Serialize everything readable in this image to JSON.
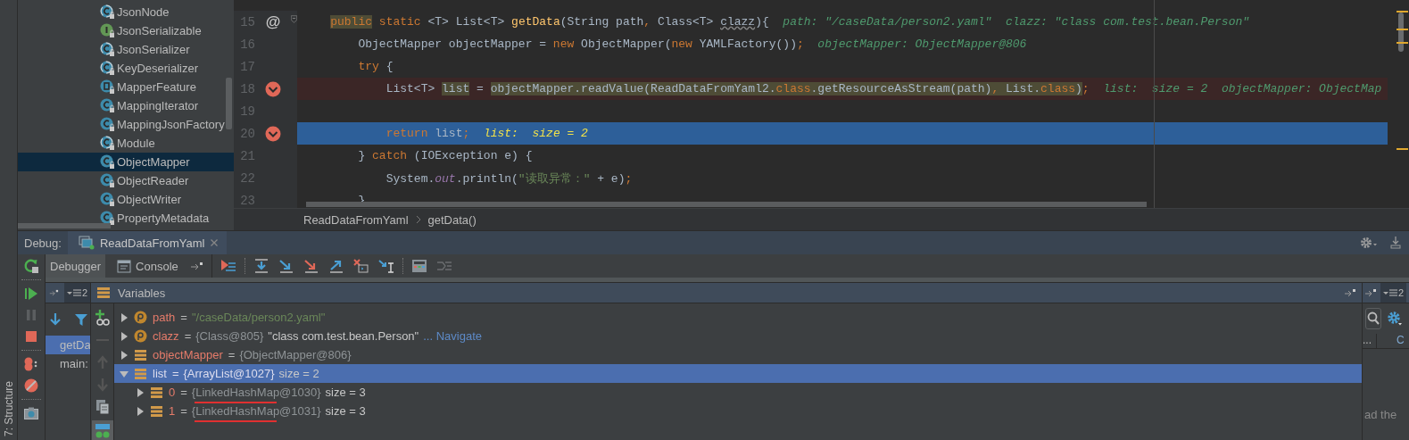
{
  "side_tab": "7: Structure",
  "project_tree": {
    "items": [
      {
        "label": "JsonNode",
        "kind": "abstract",
        "selected": false
      },
      {
        "label": "JsonSerializable",
        "kind": "interface",
        "selected": false
      },
      {
        "label": "JsonSerializer",
        "kind": "abstract",
        "selected": false
      },
      {
        "label": "KeyDeserializer",
        "kind": "abstract",
        "selected": false
      },
      {
        "label": "MapperFeature",
        "kind": "enum",
        "selected": false
      },
      {
        "label": "MappingIterator",
        "kind": "class",
        "selected": false
      },
      {
        "label": "MappingJsonFactory",
        "kind": "class",
        "selected": false
      },
      {
        "label": "Module",
        "kind": "abstract",
        "selected": false
      },
      {
        "label": "ObjectMapper",
        "kind": "class",
        "selected": true
      },
      {
        "label": "ObjectReader",
        "kind": "class",
        "selected": false
      },
      {
        "label": "ObjectWriter",
        "kind": "class",
        "selected": false
      },
      {
        "label": "PropertyMetadata",
        "kind": "class",
        "selected": false
      }
    ]
  },
  "editor": {
    "lines": [
      {
        "number": "15",
        "marker": "@",
        "breakpoint": false,
        "current": false,
        "fold": true,
        "code": [
          {
            "text": "    public",
            "kind": "usage"
          },
          {
            "text": " static ",
            "kind": "kw"
          },
          {
            "text": "<T> List<T> ",
            "kind": "plain"
          },
          {
            "text": "getData",
            "kind": "method"
          },
          {
            "text": "(String path",
            "kind": "plain"
          },
          {
            "text": ", ",
            "kind": "kw"
          },
          {
            "text": "Class<T> ",
            "kind": "plain"
          },
          {
            "text": "clazz",
            "kind": "squiggle"
          },
          {
            "text": "){",
            "kind": "plain"
          }
        ],
        "hint": "path: \"/caseData/person2.yaml\"  clazz: \"class com.test.bean.Person\""
      },
      {
        "number": "16",
        "breakpoint": false,
        "current": false,
        "fold": false,
        "code": [
          {
            "text": "        ObjectMapper objectMapper = ",
            "kind": "plain"
          },
          {
            "text": "new",
            "kind": "kw"
          },
          {
            "text": " ObjectMapper(",
            "kind": "plain"
          },
          {
            "text": "new",
            "kind": "kw"
          },
          {
            "text": " YAMLFactory())",
            "kind": "plain"
          },
          {
            "text": ";",
            "kind": "kw"
          }
        ],
        "hint": "objectMapper: ObjectMapper@806"
      },
      {
        "number": "17",
        "breakpoint": false,
        "current": false,
        "fold": false,
        "code": [
          {
            "text": "        try",
            "kind": "kw"
          },
          {
            "text": " {",
            "kind": "plain"
          }
        ]
      },
      {
        "number": "18",
        "breakpoint": true,
        "current": false,
        "fold": false,
        "code": [
          {
            "text": "            List<T> ",
            "kind": "plain"
          },
          {
            "text": "list",
            "kind": "hl"
          },
          {
            "text": " = ",
            "kind": "plain"
          },
          {
            "text": "objectMapper.readValue(ReadDataFromYaml2.",
            "kind": "hl"
          },
          {
            "text": "class",
            "kind": "hl_kw"
          },
          {
            "text": ".getResourceAsStream(path)",
            "kind": "hl"
          },
          {
            "text": ", ",
            "kind": "hl_kw"
          },
          {
            "text": "List.",
            "kind": "hl"
          },
          {
            "text": "class",
            "kind": "hl_kw"
          },
          {
            "text": ")",
            "kind": "hl"
          },
          {
            "text": ";",
            "kind": "kw"
          }
        ],
        "hint": "list:  size = 2  objectMapper: ObjectMap"
      },
      {
        "number": "19",
        "breakpoint": false,
        "current": false,
        "fold": false
      },
      {
        "number": "20",
        "breakpoint": true,
        "current": true,
        "fold": false,
        "code": [
          {
            "text": "            return",
            "kind": "kw"
          },
          {
            "text": " list",
            "kind": "plain"
          },
          {
            "text": ";",
            "kind": "kw"
          }
        ],
        "hint": "list:  size = 2"
      },
      {
        "number": "21",
        "breakpoint": false,
        "current": false,
        "fold": false,
        "code": [
          {
            "text": "        } ",
            "kind": "plain"
          },
          {
            "text": "catch",
            "kind": "kw"
          },
          {
            "text": " (IOException e) {",
            "kind": "plain"
          }
        ]
      },
      {
        "number": "22",
        "breakpoint": false,
        "current": false,
        "fold": false,
        "code": [
          {
            "text": "            System.",
            "kind": "plain"
          },
          {
            "text": "out",
            "kind": "static"
          },
          {
            "text": ".println(",
            "kind": "plain"
          },
          {
            "text": "\"读取异常：\" ",
            "kind": "string"
          },
          {
            "text": "+ e)",
            "kind": "plain"
          },
          {
            "text": ";",
            "kind": "kw"
          }
        ]
      },
      {
        "number": "23",
        "breakpoint": false,
        "current": false,
        "fold": false,
        "code": [
          {
            "text": "        }",
            "kind": "plain"
          }
        ]
      }
    ],
    "breadcrumbs": [
      "ReadDataFromYaml",
      "getData()"
    ]
  },
  "debug": {
    "title": "Debug:",
    "session_tab": "ReadDataFromYaml",
    "tabs": [
      {
        "label": "Debugger",
        "selected": true
      },
      {
        "label": "Console",
        "selected": false
      }
    ],
    "frames_count": "2",
    "frames": [
      {
        "label": "getDa",
        "selected": true
      },
      {
        "label": "main:",
        "selected": false
      }
    ],
    "variables_title": "Variables",
    "variables": [
      {
        "name": "path",
        "kind": "param",
        "selected": false,
        "expanded": false,
        "annotated": false,
        "value": [
          {
            "text": "=",
            "kind": "op"
          },
          {
            "text": "\"/caseData/person2.yaml\"",
            "kind": "string"
          }
        ]
      },
      {
        "name": "clazz",
        "kind": "param",
        "selected": false,
        "expanded": false,
        "annotated": false,
        "value": [
          {
            "text": "=",
            "kind": "op"
          },
          {
            "text": "{Class@805}",
            "kind": "ref"
          },
          {
            "text": "\"class com.test.bean.Person\"",
            "kind": "text"
          },
          {
            "text": "... Navigate",
            "kind": "link"
          }
        ]
      },
      {
        "name": "objectMapper",
        "kind": "field",
        "selected": false,
        "expanded": false,
        "annotated": false,
        "value": [
          {
            "text": "=",
            "kind": "op"
          },
          {
            "text": "{ObjectMapper@806}",
            "kind": "ref"
          }
        ]
      },
      {
        "name": "list",
        "kind": "field",
        "selected": true,
        "expanded": true,
        "annotated": false,
        "value": [
          {
            "text": "=",
            "kind": "op"
          },
          {
            "text": "{ArrayList@1027}",
            "kind": "ref"
          },
          {
            "text": "size = 2",
            "kind": "text"
          }
        ],
        "children": [
          {
            "name": "0",
            "kind": "field",
            "selected": false,
            "expanded": false,
            "annotated": true,
            "value": [
              {
                "text": "=",
                "kind": "op"
              },
              {
                "text": "{LinkedHashMap@1030}",
                "kind": "ref"
              },
              {
                "text": "size = 3",
                "kind": "text"
              }
            ]
          },
          {
            "name": "1",
            "kind": "field",
            "selected": false,
            "expanded": false,
            "annotated": true,
            "value": [
              {
                "text": "=",
                "kind": "op"
              },
              {
                "text": "{LinkedHashMap@1031}",
                "kind": "ref"
              },
              {
                "text": "size = 3",
                "kind": "text"
              }
            ]
          }
        ]
      }
    ],
    "right_pane": {
      "count": "2",
      "column_1": "...",
      "column_2": "C",
      "text": "ad the"
    }
  }
}
